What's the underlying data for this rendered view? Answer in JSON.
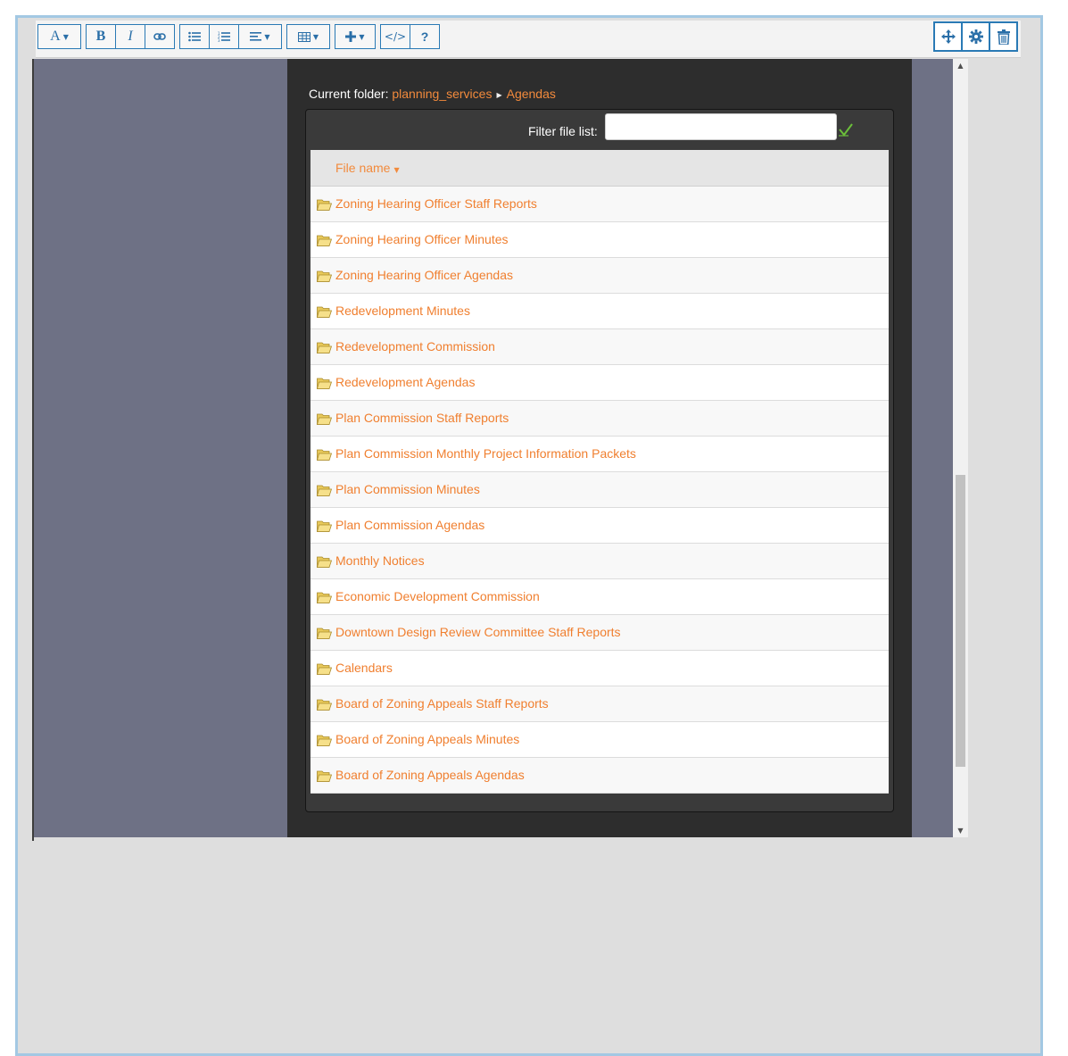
{
  "toolbar": {
    "groups": [
      {
        "items": [
          {
            "icon": "font-icon",
            "label": "A",
            "dropdown": true
          }
        ]
      },
      {
        "items": [
          {
            "icon": "bold-icon",
            "label": "B"
          },
          {
            "icon": "italic-icon",
            "label": "I"
          },
          {
            "icon": "link-icon",
            "label": ""
          }
        ]
      },
      {
        "items": [
          {
            "icon": "bullet-list-icon",
            "label": ""
          },
          {
            "icon": "numbered-list-icon",
            "label": ""
          },
          {
            "icon": "align-icon",
            "label": "",
            "dropdown": true
          }
        ]
      },
      {
        "items": [
          {
            "icon": "table-icon",
            "label": "",
            "dropdown": true
          }
        ]
      },
      {
        "items": [
          {
            "icon": "plus-icon",
            "label": "",
            "dropdown": true
          }
        ]
      },
      {
        "items": [
          {
            "icon": "code-icon",
            "label": "</>"
          },
          {
            "icon": "help-icon",
            "label": "?"
          }
        ]
      }
    ],
    "right_buttons": [
      {
        "icon": "move-icon"
      },
      {
        "icon": "gear-icon"
      },
      {
        "icon": "trash-icon"
      }
    ],
    "accent": "#2a7ab5"
  },
  "browser": {
    "current_folder_label": "Current folder:",
    "breadcrumb": [
      "planning_services",
      "Agendas"
    ],
    "filter_label": "Filter file list:",
    "filter_value": "",
    "filter_placeholder": "",
    "column_header": "File name",
    "link_color": "#f07f2f",
    "files": [
      "Zoning Hearing Officer Staff Reports",
      "Zoning Hearing Officer Minutes",
      "Zoning Hearing Officer Agendas",
      "Redevelopment Minutes",
      "Redevelopment Commission",
      "Redevelopment Agendas",
      "Plan Commission Staff Reports",
      "Plan Commission Monthly Project Information Packets",
      "Plan Commission Minutes",
      "Plan Commission Agendas",
      "Monthly Notices",
      "Economic Development Commission",
      "Downtown Design Review Committee Staff Reports",
      "Calendars",
      "Board of Zoning Appeals Staff Reports",
      "Board of Zoning Appeals Minutes",
      "Board of Zoning Appeals Agendas"
    ]
  }
}
